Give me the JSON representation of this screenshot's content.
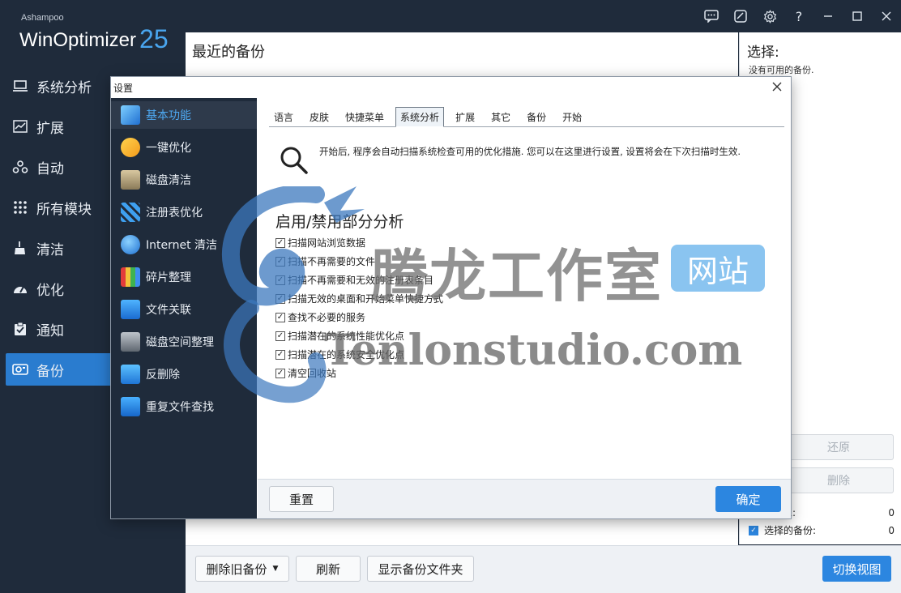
{
  "app": {
    "brand_small": "Ashampoo",
    "brand_name": "WinOptimizer",
    "brand_version": "25"
  },
  "sidebar": {
    "items": [
      {
        "label": "系统分析",
        "icon": "laptop-icon"
      },
      {
        "label": "扩展",
        "icon": "chart-icon"
      },
      {
        "label": "自动",
        "icon": "workflow-icon"
      },
      {
        "label": "所有模块",
        "icon": "grid-dots-icon"
      },
      {
        "label": "清洁",
        "icon": "broom-icon"
      },
      {
        "label": "优化",
        "icon": "speedometer-icon"
      },
      {
        "label": "通知",
        "icon": "clipboard-check-icon"
      },
      {
        "label": "备份",
        "icon": "backup-icon"
      }
    ]
  },
  "content": {
    "title": "最近的备份",
    "buttons": {
      "delete_old": "删除旧备份",
      "refresh": "刷新",
      "show_folder": "显示备份文件夹",
      "switch_view": "切换视图"
    }
  },
  "right_panel": {
    "title": "选择:",
    "subtitle": "没有可用的备份.",
    "restore": "还原",
    "delete": "删除",
    "row1_label": "总:",
    "row1_count": "0",
    "row2_label": "选择的备份:",
    "row2_count": "0"
  },
  "dialog": {
    "title": "设置",
    "side_items": [
      {
        "label": "基本功能"
      },
      {
        "label": "一键优化"
      },
      {
        "label": "磁盘清洁"
      },
      {
        "label": "注册表优化"
      },
      {
        "label": "Internet 清洁"
      },
      {
        "label": "碎片整理"
      },
      {
        "label": "文件关联"
      },
      {
        "label": "磁盘空间整理"
      },
      {
        "label": "反删除"
      },
      {
        "label": "重复文件查找"
      }
    ],
    "tabs": [
      "语言",
      "皮肤",
      "快捷菜单",
      "系统分析",
      "扩展",
      "其它",
      "备份",
      "开始"
    ],
    "info": "开始后, 程序会自动扫描系统检查可用的优化措施. 您可以在这里进行设置, 设置将会在下次扫描时生效.",
    "section_title": "启用/禁用部分分析",
    "checks": [
      "扫描网站浏览数据",
      "扫描不再需要的文件",
      "扫描不再需要和无效的注册表条目",
      "扫描无效的桌面和开始菜单快捷方式",
      "查找不必要的服务",
      "扫描潜在的系统性能优化点",
      "扫描潜在的系统安全优化点",
      "清空回收站"
    ],
    "reset": "重置",
    "ok": "确定"
  },
  "watermark": {
    "cn": "腾龙工作室",
    "badge": "网站",
    "url": "Tenlonstudio.com"
  },
  "colors": {
    "sidebar_bg": "#1f2b3b",
    "accent": "#2c86e0",
    "active_text": "#4ea9f2"
  }
}
